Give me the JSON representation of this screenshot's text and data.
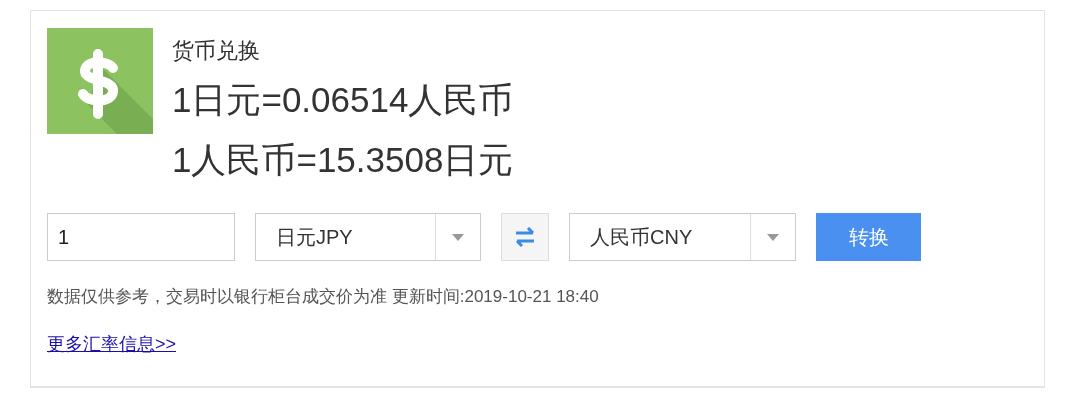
{
  "widget": {
    "title": "货币兑换",
    "rates": [
      "1日元=0.06514人民币",
      "1人民币=15.3508日元"
    ],
    "amount": "1",
    "from_currency": "日元JPY",
    "to_currency": "人民币CNY",
    "convert_button": "转换",
    "note": "数据仅供参考，交易时以银行柜台成交价为准 更新时间:2019-10-21 18:40",
    "more_link": "更多汇率信息>>"
  }
}
